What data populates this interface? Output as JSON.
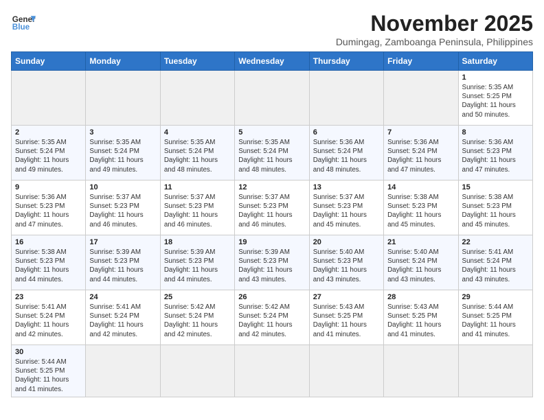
{
  "header": {
    "logo_line1": "General",
    "logo_line2": "Blue",
    "month": "November 2025",
    "location": "Dumingag, Zamboanga Peninsula, Philippines"
  },
  "weekdays": [
    "Sunday",
    "Monday",
    "Tuesday",
    "Wednesday",
    "Thursday",
    "Friday",
    "Saturday"
  ],
  "weeks": [
    [
      {
        "day": "",
        "info": ""
      },
      {
        "day": "",
        "info": ""
      },
      {
        "day": "",
        "info": ""
      },
      {
        "day": "",
        "info": ""
      },
      {
        "day": "",
        "info": ""
      },
      {
        "day": "",
        "info": ""
      },
      {
        "day": "1",
        "info": "Sunrise: 5:35 AM\nSunset: 5:25 PM\nDaylight: 11 hours\nand 50 minutes."
      }
    ],
    [
      {
        "day": "2",
        "info": "Sunrise: 5:35 AM\nSunset: 5:24 PM\nDaylight: 11 hours\nand 49 minutes."
      },
      {
        "day": "3",
        "info": "Sunrise: 5:35 AM\nSunset: 5:24 PM\nDaylight: 11 hours\nand 49 minutes."
      },
      {
        "day": "4",
        "info": "Sunrise: 5:35 AM\nSunset: 5:24 PM\nDaylight: 11 hours\nand 48 minutes."
      },
      {
        "day": "5",
        "info": "Sunrise: 5:35 AM\nSunset: 5:24 PM\nDaylight: 11 hours\nand 48 minutes."
      },
      {
        "day": "6",
        "info": "Sunrise: 5:36 AM\nSunset: 5:24 PM\nDaylight: 11 hours\nand 48 minutes."
      },
      {
        "day": "7",
        "info": "Sunrise: 5:36 AM\nSunset: 5:24 PM\nDaylight: 11 hours\nand 47 minutes."
      },
      {
        "day": "8",
        "info": "Sunrise: 5:36 AM\nSunset: 5:23 PM\nDaylight: 11 hours\nand 47 minutes."
      }
    ],
    [
      {
        "day": "9",
        "info": "Sunrise: 5:36 AM\nSunset: 5:23 PM\nDaylight: 11 hours\nand 47 minutes."
      },
      {
        "day": "10",
        "info": "Sunrise: 5:37 AM\nSunset: 5:23 PM\nDaylight: 11 hours\nand 46 minutes."
      },
      {
        "day": "11",
        "info": "Sunrise: 5:37 AM\nSunset: 5:23 PM\nDaylight: 11 hours\nand 46 minutes."
      },
      {
        "day": "12",
        "info": "Sunrise: 5:37 AM\nSunset: 5:23 PM\nDaylight: 11 hours\nand 46 minutes."
      },
      {
        "day": "13",
        "info": "Sunrise: 5:37 AM\nSunset: 5:23 PM\nDaylight: 11 hours\nand 45 minutes."
      },
      {
        "day": "14",
        "info": "Sunrise: 5:38 AM\nSunset: 5:23 PM\nDaylight: 11 hours\nand 45 minutes."
      },
      {
        "day": "15",
        "info": "Sunrise: 5:38 AM\nSunset: 5:23 PM\nDaylight: 11 hours\nand 45 minutes."
      }
    ],
    [
      {
        "day": "16",
        "info": "Sunrise: 5:38 AM\nSunset: 5:23 PM\nDaylight: 11 hours\nand 44 minutes."
      },
      {
        "day": "17",
        "info": "Sunrise: 5:39 AM\nSunset: 5:23 PM\nDaylight: 11 hours\nand 44 minutes."
      },
      {
        "day": "18",
        "info": "Sunrise: 5:39 AM\nSunset: 5:23 PM\nDaylight: 11 hours\nand 44 minutes."
      },
      {
        "day": "19",
        "info": "Sunrise: 5:39 AM\nSunset: 5:23 PM\nDaylight: 11 hours\nand 43 minutes."
      },
      {
        "day": "20",
        "info": "Sunrise: 5:40 AM\nSunset: 5:23 PM\nDaylight: 11 hours\nand 43 minutes."
      },
      {
        "day": "21",
        "info": "Sunrise: 5:40 AM\nSunset: 5:24 PM\nDaylight: 11 hours\nand 43 minutes."
      },
      {
        "day": "22",
        "info": "Sunrise: 5:41 AM\nSunset: 5:24 PM\nDaylight: 11 hours\nand 43 minutes."
      }
    ],
    [
      {
        "day": "23",
        "info": "Sunrise: 5:41 AM\nSunset: 5:24 PM\nDaylight: 11 hours\nand 42 minutes."
      },
      {
        "day": "24",
        "info": "Sunrise: 5:41 AM\nSunset: 5:24 PM\nDaylight: 11 hours\nand 42 minutes."
      },
      {
        "day": "25",
        "info": "Sunrise: 5:42 AM\nSunset: 5:24 PM\nDaylight: 11 hours\nand 42 minutes."
      },
      {
        "day": "26",
        "info": "Sunrise: 5:42 AM\nSunset: 5:24 PM\nDaylight: 11 hours\nand 42 minutes."
      },
      {
        "day": "27",
        "info": "Sunrise: 5:43 AM\nSunset: 5:25 PM\nDaylight: 11 hours\nand 41 minutes."
      },
      {
        "day": "28",
        "info": "Sunrise: 5:43 AM\nSunset: 5:25 PM\nDaylight: 11 hours\nand 41 minutes."
      },
      {
        "day": "29",
        "info": "Sunrise: 5:44 AM\nSunset: 5:25 PM\nDaylight: 11 hours\nand 41 minutes."
      }
    ],
    [
      {
        "day": "30",
        "info": "Sunrise: 5:44 AM\nSunset: 5:25 PM\nDaylight: 11 hours\nand 41 minutes."
      },
      {
        "day": "",
        "info": ""
      },
      {
        "day": "",
        "info": ""
      },
      {
        "day": "",
        "info": ""
      },
      {
        "day": "",
        "info": ""
      },
      {
        "day": "",
        "info": ""
      },
      {
        "day": "",
        "info": ""
      }
    ]
  ]
}
